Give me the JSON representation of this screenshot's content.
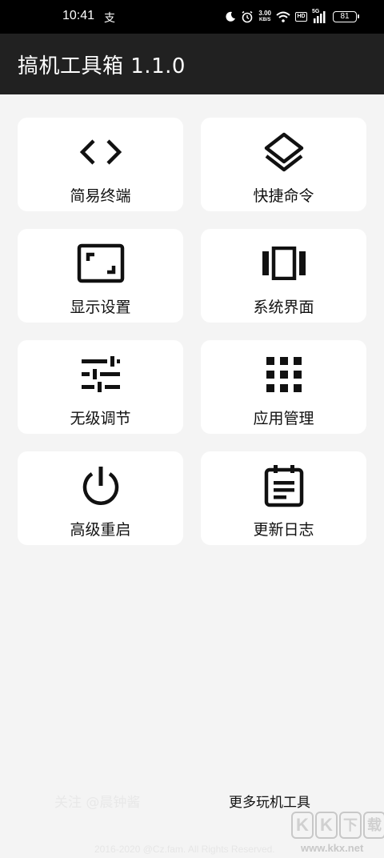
{
  "status_bar": {
    "time": "10:41",
    "notification_glyph": "支",
    "speed_value": "3.00",
    "speed_unit": "KB/S",
    "hd": "HD",
    "network": "5G",
    "battery": "81"
  },
  "app_bar": {
    "title": "搞机工具箱 1.1.0"
  },
  "tiles": [
    {
      "label": "简易终端",
      "icon": "code-icon"
    },
    {
      "label": "快捷命令",
      "icon": "layers-icon"
    },
    {
      "label": "显示设置",
      "icon": "aspect-ratio-icon"
    },
    {
      "label": "系统界面",
      "icon": "view-carousel-icon"
    },
    {
      "label": "无级调节",
      "icon": "tune-icon"
    },
    {
      "label": "应用管理",
      "icon": "apps-grid-icon"
    },
    {
      "label": "高级重启",
      "icon": "power-icon"
    },
    {
      "label": "更新日志",
      "icon": "event-note-icon"
    }
  ],
  "footer": {
    "follow_link": "关注 @晨钟酱",
    "more_tools_link": "更多玩机工具",
    "copyright": "2016-2020 @Cz.fam. All Rights Reserved."
  },
  "watermark": {
    "logo": [
      "K",
      "K",
      "下",
      "载"
    ],
    "url": "www.kkx.net"
  }
}
